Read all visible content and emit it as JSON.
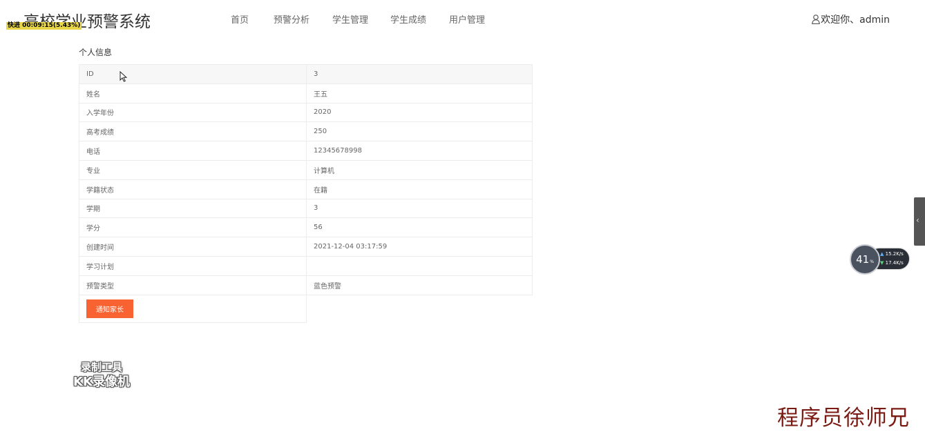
{
  "header": {
    "logo": "高校学业预警系统",
    "recording_badge": "快进 00:09:15(5.43%)",
    "nav": [
      {
        "label": "首页"
      },
      {
        "label": "预警分析"
      },
      {
        "label": "学生管理"
      },
      {
        "label": "学生成绩"
      },
      {
        "label": "用户管理"
      }
    ],
    "user_greeting": "欢迎你、admin",
    "user_icon": "user-icon"
  },
  "profile": {
    "title": "个人信息",
    "rows": [
      {
        "key": "ID",
        "value": "3"
      },
      {
        "key": "姓名",
        "value": "王五"
      },
      {
        "key": "入学年份",
        "value": "2020"
      },
      {
        "key": "高考成绩",
        "value": "250"
      },
      {
        "key": "电话",
        "value": "12345678998"
      },
      {
        "key": "专业",
        "value": "计算机"
      },
      {
        "key": "学籍状态",
        "value": "在籍"
      },
      {
        "key": "学期",
        "value": "3"
      },
      {
        "key": "学分",
        "value": "56"
      },
      {
        "key": "创建时间",
        "value": "2021-12-04 03:17:59"
      },
      {
        "key": "学习计划",
        "value": ""
      },
      {
        "key": "预警类型",
        "value": "蓝色预警"
      }
    ],
    "notify_button": "通知家长"
  },
  "speed_widget": {
    "percent": "41",
    "percent_unit": "%",
    "upload": "15.2",
    "download": "17.4",
    "unit": "K/s"
  },
  "watermarks": {
    "tool_line1": "录制工具",
    "tool_line2": "KK录像机",
    "author": "程序员徐师兄"
  },
  "colors": {
    "accent": "#f96332",
    "author_watermark": "#7a1a12"
  }
}
